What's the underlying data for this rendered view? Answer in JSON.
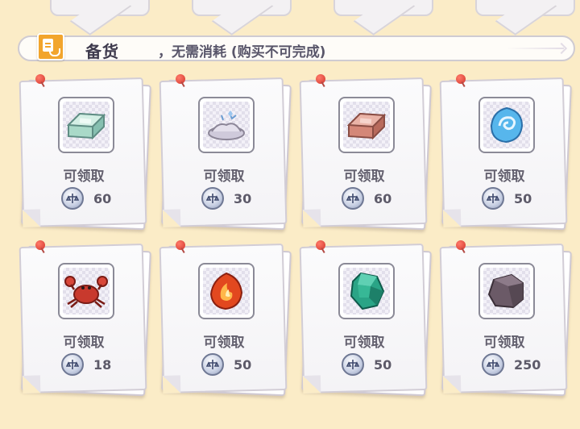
{
  "header": {
    "title": "备货",
    "description": "，无需消耗 (购买不可完成)"
  },
  "items": [
    {
      "name": "silver-ingot",
      "status": "可领取",
      "price": "60",
      "color": "#b8e0d2"
    },
    {
      "name": "ore-pile",
      "status": "可领取",
      "price": "30",
      "color": "#d6d2df"
    },
    {
      "name": "copper-ingot",
      "status": "可领取",
      "price": "60",
      "color": "#d98a7d"
    },
    {
      "name": "blue-swirl-gem",
      "status": "可领取",
      "price": "50",
      "color": "#4fb3ea"
    },
    {
      "name": "red-crab",
      "status": "可领取",
      "price": "18",
      "color": "#c9392e"
    },
    {
      "name": "fire-gem",
      "status": "可领取",
      "price": "50",
      "color": "#e34a22"
    },
    {
      "name": "green-crystal",
      "status": "可领取",
      "price": "50",
      "color": "#2ba88a"
    },
    {
      "name": "dark-rock",
      "status": "可领取",
      "price": "250",
      "color": "#6b5965"
    }
  ],
  "colors": {
    "background": "#fbecc7",
    "text": "#64616f",
    "header_icon": "#f2a52d"
  }
}
